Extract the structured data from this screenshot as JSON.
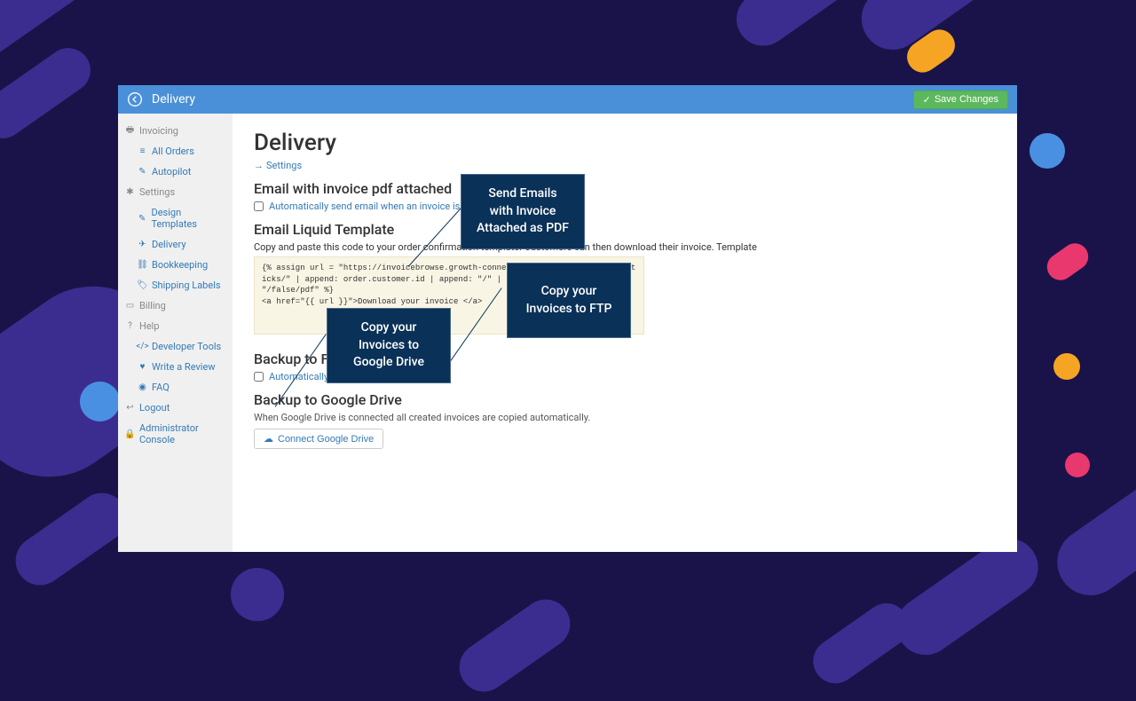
{
  "topbar": {
    "title": "Delivery",
    "save_label": "Save Changes"
  },
  "sidebar": {
    "groups": [
      {
        "label": "Invoicing",
        "items": [
          "All Orders",
          "Autopilot"
        ]
      },
      {
        "label": "Settings",
        "items": [
          "Design Templates",
          "Delivery",
          "Bookkeeping",
          "Shipping Labels"
        ]
      },
      {
        "label": "Billing",
        "items": []
      },
      {
        "label": "Help",
        "items": [
          "Developer Tools",
          "Write a Review",
          "FAQ"
        ]
      },
      {
        "label": "Logout",
        "items": []
      },
      {
        "label": "Administrator Console",
        "items": []
      }
    ]
  },
  "main": {
    "heading": "Delivery",
    "breadcrumb": "Settings",
    "section_email_heading": "Email with invoice pdf attached",
    "email_checkbox_label": "Automatically send email when an invoice is created.",
    "section_liquid_heading": "Email Liquid Template",
    "liquid_helper": "Copy and paste this code to your order confirmation template. Customers can then download their invoice. Template",
    "liquid_code": "{% assign url = \"https://invoicebrowse.growth-connections.com/order/discountsticks/\" | append: order.customer.id | append: \"/\" | append: order.id | append: \"/false/pdf\" %}\n<a href=\"{{ url }}\">Download your invoice </a>",
    "section_ftp_heading": "Backup to FTP",
    "ftp_checkbox_label": "Automatically copy invoices to FTP",
    "section_gdrive_heading": "Backup to Google Drive",
    "gdrive_helper": "When Google Drive is connected all created invoices are copied automatically.",
    "connect_gdrive_label": "Connect Google Drive"
  },
  "callouts": {
    "c1": "Send Emails with Invoice Attached as PDF",
    "c2": "Copy your Invoices to FTP",
    "c3": "Copy your Invoices to Google Drive"
  }
}
